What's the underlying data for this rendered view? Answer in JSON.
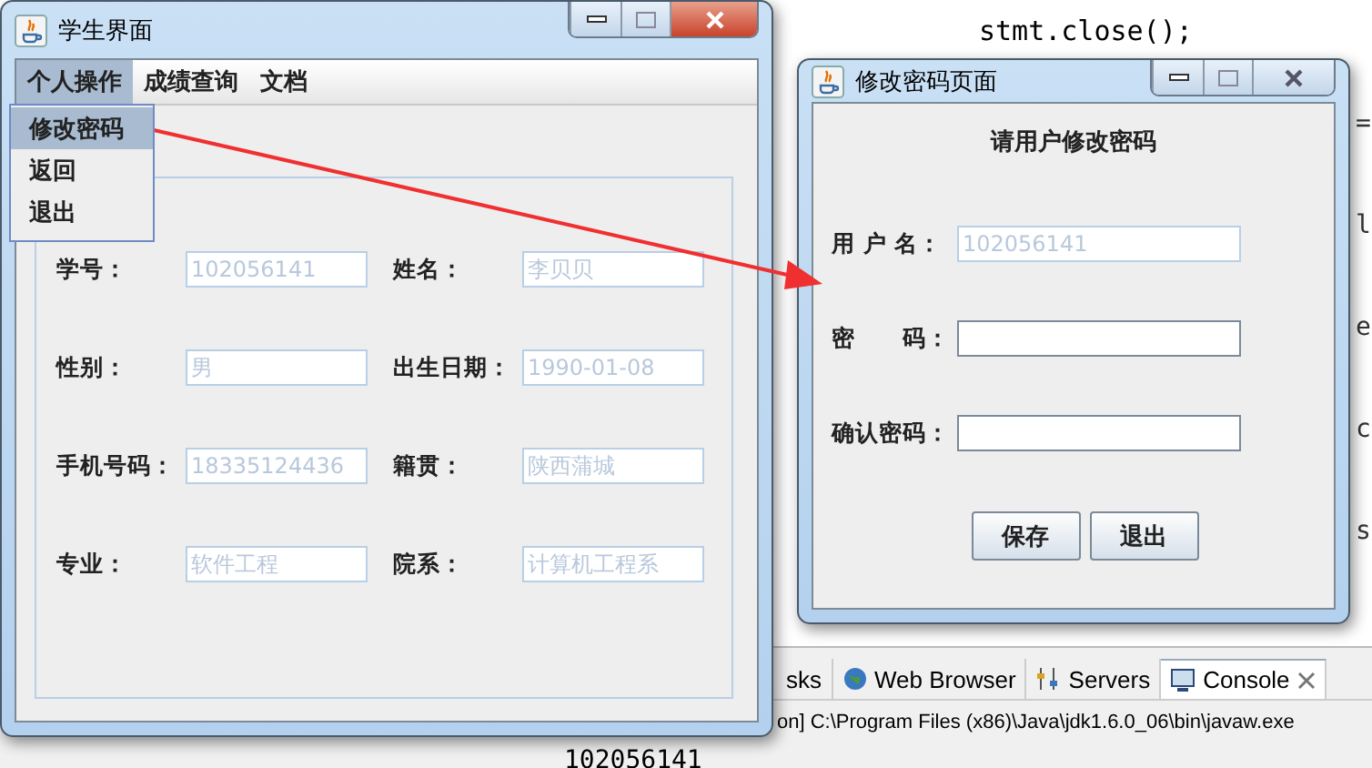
{
  "editor": {
    "code_lines": [
      "stmt.close();"
    ],
    "side_fragments": [
      "=",
      "l",
      "e",
      "c",
      "s"
    ]
  },
  "bottom_panel": {
    "tabs": [
      {
        "label": "sks",
        "selected": false
      },
      {
        "label": "Web Browser",
        "selected": false
      },
      {
        "label": "Servers",
        "selected": false
      },
      {
        "label": "Console",
        "selected": true
      }
    ],
    "console_line": "on] C:\\Program Files (x86)\\Java\\jdk1.6.0_06\\bin\\javaw.exe",
    "output_line": "102056141"
  },
  "student_window": {
    "title": "学生界面",
    "menu": [
      {
        "label": "个人操作",
        "selected": true
      },
      {
        "label": "成绩查询",
        "selected": false
      },
      {
        "label": "文档",
        "selected": false
      }
    ],
    "dropdown": [
      {
        "label": "修改密码",
        "selected": true
      },
      {
        "label": "返回",
        "selected": false
      },
      {
        "label": "退出",
        "selected": false
      }
    ],
    "fields": [
      {
        "label": "学号：",
        "value": "102056141"
      },
      {
        "label": "姓名：",
        "value": "李贝贝"
      },
      {
        "label": "性别：",
        "value": "男"
      },
      {
        "label": "出生日期：",
        "value": "1990-01-08"
      },
      {
        "label": "手机号码：",
        "value": "18335124436"
      },
      {
        "label": "籍贯：",
        "value": "陕西蒲城"
      },
      {
        "label": "专业：",
        "value": "软件工程"
      },
      {
        "label": "院系：",
        "value": "计算机工程系"
      }
    ]
  },
  "password_window": {
    "title": "修改密码页面",
    "heading": "请用户修改密码",
    "fields": [
      {
        "label": "用 户 名：",
        "value": "102056141",
        "disabled": true
      },
      {
        "label": "密　　码：",
        "disabled": false
      },
      {
        "label": "确认密码：",
        "disabled": false
      }
    ],
    "buttons": [
      "保存",
      "退出"
    ]
  }
}
